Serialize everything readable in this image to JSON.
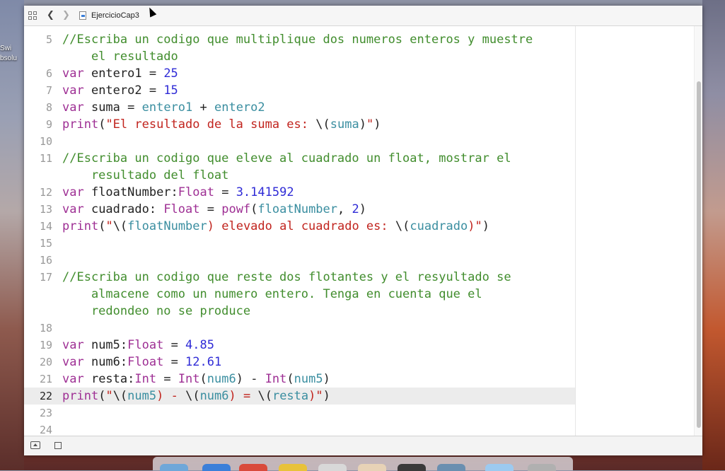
{
  "window": {
    "breadcrumb": "EjercicioCap3"
  },
  "desktop": {
    "left_label_line1": "Swi",
    "left_label_line2": "bsolu"
  },
  "editor": {
    "lines": [
      {
        "num": "5",
        "tokens": [
          {
            "t": "//Escriba un codigo que multiplique dos numeros enteros y muestre",
            "k": "c"
          }
        ]
      },
      {
        "num": "",
        "tokens": [
          {
            "t": "    el resultado",
            "k": "c"
          }
        ]
      },
      {
        "num": "6",
        "tokens": [
          {
            "t": "var",
            "k": "k"
          },
          {
            "t": " entero1 = ",
            "k": "p"
          },
          {
            "t": "25",
            "k": "n"
          }
        ]
      },
      {
        "num": "7",
        "tokens": [
          {
            "t": "var",
            "k": "k"
          },
          {
            "t": " entero2 = ",
            "k": "p"
          },
          {
            "t": "15",
            "k": "n"
          }
        ]
      },
      {
        "num": "8",
        "tokens": [
          {
            "t": "var",
            "k": "k"
          },
          {
            "t": " suma = ",
            "k": "p"
          },
          {
            "t": "entero1",
            "k": "v"
          },
          {
            "t": " + ",
            "k": "p"
          },
          {
            "t": "entero2",
            "k": "v"
          }
        ]
      },
      {
        "num": "9",
        "tokens": [
          {
            "t": "print",
            "k": "k"
          },
          {
            "t": "(",
            "k": "p"
          },
          {
            "t": "\"El resultado de la suma es: ",
            "k": "s"
          },
          {
            "t": "\\(",
            "k": "p"
          },
          {
            "t": "suma",
            "k": "v"
          },
          {
            "t": ")",
            "k": "p"
          },
          {
            "t": "\"",
            "k": "s"
          },
          {
            "t": ")",
            "k": "p"
          }
        ]
      },
      {
        "num": "10",
        "tokens": []
      },
      {
        "num": "11",
        "tokens": [
          {
            "t": "//Escriba un codigo que eleve al cuadrado un float, mostrar el",
            "k": "c"
          }
        ]
      },
      {
        "num": "",
        "tokens": [
          {
            "t": "    resultado del float",
            "k": "c"
          }
        ]
      },
      {
        "num": "12",
        "tokens": [
          {
            "t": "var",
            "k": "k"
          },
          {
            "t": " floatNumber:",
            "k": "p"
          },
          {
            "t": "Float",
            "k": "k"
          },
          {
            "t": " = ",
            "k": "p"
          },
          {
            "t": "3.141592",
            "k": "n"
          }
        ]
      },
      {
        "num": "13",
        "tokens": [
          {
            "t": "var",
            "k": "k"
          },
          {
            "t": " cuadrado: ",
            "k": "p"
          },
          {
            "t": "Float",
            "k": "k"
          },
          {
            "t": " = ",
            "k": "p"
          },
          {
            "t": "powf",
            "k": "k"
          },
          {
            "t": "(",
            "k": "p"
          },
          {
            "t": "floatNumber",
            "k": "v"
          },
          {
            "t": ", ",
            "k": "p"
          },
          {
            "t": "2",
            "k": "n"
          },
          {
            "t": ")",
            "k": "p"
          }
        ]
      },
      {
        "num": "14",
        "tokens": [
          {
            "t": "print",
            "k": "k"
          },
          {
            "t": "(",
            "k": "p"
          },
          {
            "t": "\"",
            "k": "s"
          },
          {
            "t": "\\(",
            "k": "p"
          },
          {
            "t": "floatNumber",
            "k": "v"
          },
          {
            "t": ") elevado al cuadrado es: ",
            "k": "s"
          },
          {
            "t": "\\(",
            "k": "p"
          },
          {
            "t": "cuadrado",
            "k": "v"
          },
          {
            "t": ")\"",
            "k": "s"
          },
          {
            "t": ")",
            "k": "p"
          }
        ]
      },
      {
        "num": "15",
        "tokens": []
      },
      {
        "num": "16",
        "tokens": []
      },
      {
        "num": "17",
        "tokens": [
          {
            "t": "//Escriba un codigo que reste dos flotantes y el resyultado se",
            "k": "c"
          }
        ]
      },
      {
        "num": "",
        "tokens": [
          {
            "t": "    almacene como un numero entero. Tenga en cuenta que el",
            "k": "c"
          }
        ]
      },
      {
        "num": "",
        "tokens": [
          {
            "t": "    redondeo no se produce",
            "k": "c"
          }
        ]
      },
      {
        "num": "18",
        "tokens": []
      },
      {
        "num": "19",
        "tokens": [
          {
            "t": "var",
            "k": "k"
          },
          {
            "t": " num5:",
            "k": "p"
          },
          {
            "t": "Float",
            "k": "k"
          },
          {
            "t": " = ",
            "k": "p"
          },
          {
            "t": "4.85",
            "k": "n"
          }
        ]
      },
      {
        "num": "20",
        "tokens": [
          {
            "t": "var",
            "k": "k"
          },
          {
            "t": " num6:",
            "k": "p"
          },
          {
            "t": "Float",
            "k": "k"
          },
          {
            "t": " = ",
            "k": "p"
          },
          {
            "t": "12.61",
            "k": "n"
          }
        ]
      },
      {
        "num": "21",
        "tokens": [
          {
            "t": "var",
            "k": "k"
          },
          {
            "t": " resta:",
            "k": "p"
          },
          {
            "t": "Int",
            "k": "k"
          },
          {
            "t": " = ",
            "k": "p"
          },
          {
            "t": "Int",
            "k": "k"
          },
          {
            "t": "(",
            "k": "p"
          },
          {
            "t": "num6",
            "k": "v"
          },
          {
            "t": ") - ",
            "k": "p"
          },
          {
            "t": "Int",
            "k": "k"
          },
          {
            "t": "(",
            "k": "p"
          },
          {
            "t": "num5",
            "k": "v"
          },
          {
            "t": ")",
            "k": "p"
          }
        ]
      },
      {
        "num": "22",
        "current": true,
        "tokens": [
          {
            "t": "print",
            "k": "k"
          },
          {
            "t": "(",
            "k": "p"
          },
          {
            "t": "\"",
            "k": "s"
          },
          {
            "t": "\\(",
            "k": "p"
          },
          {
            "t": "num5",
            "k": "v"
          },
          {
            "t": ") - ",
            "k": "s"
          },
          {
            "t": "\\(",
            "k": "p"
          },
          {
            "t": "num6",
            "k": "v"
          },
          {
            "t": ") = ",
            "k": "s"
          },
          {
            "t": "\\(",
            "k": "p"
          },
          {
            "t": "resta",
            "k": "v"
          },
          {
            "t": ")\"",
            "k": "s"
          },
          {
            "t": ")",
            "k": "p"
          }
        ]
      },
      {
        "num": "23",
        "tokens": []
      },
      {
        "num": "24",
        "tokens": []
      }
    ]
  },
  "colors": {
    "comment": "#418d2d",
    "keyword": "#9e2f94",
    "number": "#2f2bd6",
    "variable": "#3a8ea0",
    "string": "#c1241e"
  }
}
